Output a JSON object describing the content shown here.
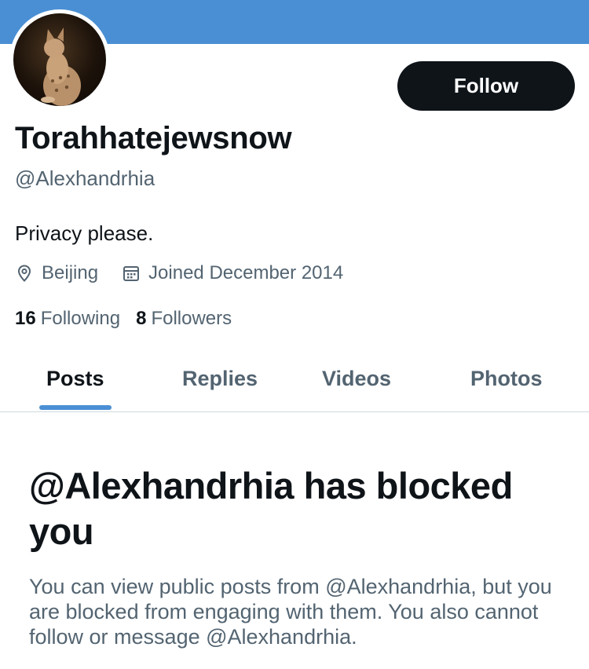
{
  "profile": {
    "display_name": "Torahhatejewsnow",
    "handle": "@Alexhandrhia",
    "bio": "Privacy please.",
    "location": "Beijing",
    "joined": "Joined December 2014",
    "following_count": "16",
    "following_label": "Following",
    "followers_count": "8",
    "followers_label": "Followers"
  },
  "actions": {
    "follow_label": "Follow"
  },
  "tabs": [
    {
      "label": "Posts",
      "active": true
    },
    {
      "label": "Replies",
      "active": false
    },
    {
      "label": "Videos",
      "active": false
    },
    {
      "label": "Photos",
      "active": false
    }
  ],
  "blocked": {
    "title": "@Alexhandrhia has blocked you",
    "message": "You can view public posts from @Alexhandrhia, but you are blocked from engaging with them. You also cannot follow or message @Alexhandrhia."
  },
  "icons": {
    "location": "location-pin-icon",
    "calendar": "calendar-icon"
  },
  "colors": {
    "banner": "#4a8fd4",
    "accent": "#4a8fd4",
    "button": "#0f1419",
    "muted_text": "#536471"
  }
}
